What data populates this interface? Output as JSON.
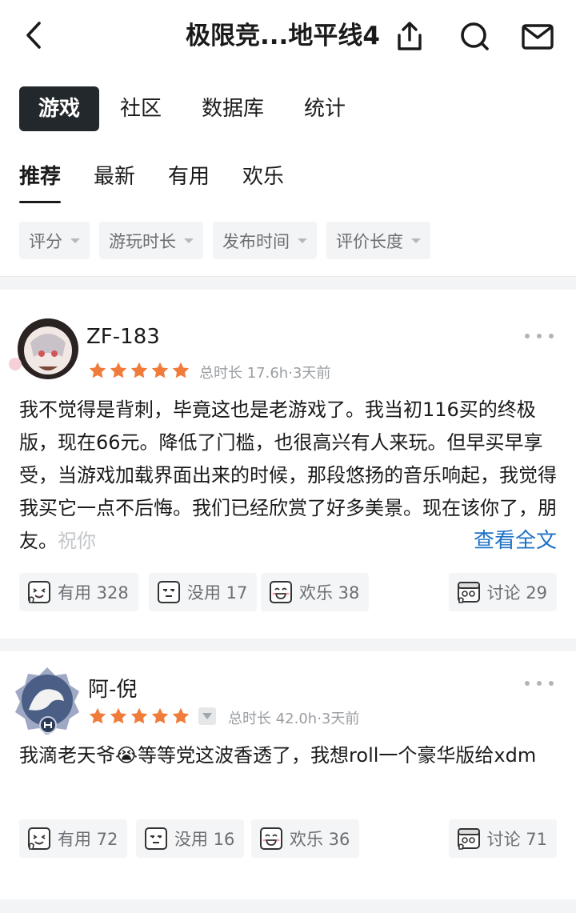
{
  "header": {
    "title": "极限竞...地平线4"
  },
  "main_tabs": [
    "游戏",
    "社区",
    "数据库",
    "统计"
  ],
  "sub_tabs": [
    "推荐",
    "最新",
    "有用",
    "欢乐"
  ],
  "filters": [
    "评分",
    "游玩时长",
    "发布时间",
    "评价长度"
  ],
  "colors": {
    "star": "#f07c3c",
    "link": "#1f72c8",
    "active_tab_bg": "#23282c"
  },
  "reviews": [
    {
      "username": "ZF-183",
      "rating": 5,
      "meta": "总时长 17.6h·3天前",
      "body": "我不觉得是背刺，毕竟这也是老游戏了。我当初116买的终极版，现在66元。降低了门槛，也很高兴有人来玩。但早买早享受，当游戏加载界面出来的时候，那段悠扬的音乐响起，我觉得我买它一点不后悔。我们已经欣赏了好多美景。现在该你了，朋友。",
      "body_fade": "祝你",
      "read_more": "查看全文",
      "actions": {
        "useful": "有用 328",
        "useless": "没用 17",
        "funny": "欢乐 38",
        "discuss": "讨论 29"
      }
    },
    {
      "username": "阿-倪",
      "rating": 5,
      "meta": "总时长 42.0h·3天前",
      "body_pre": "我滴老天爷",
      "emoji": "😭",
      "body_post": "等等党这波香透了，我想roll一个豪华版给xdm",
      "actions": {
        "useful": "有用 72",
        "useless": "没用 16",
        "funny": "欢乐 36",
        "discuss": "讨论 71"
      }
    }
  ]
}
